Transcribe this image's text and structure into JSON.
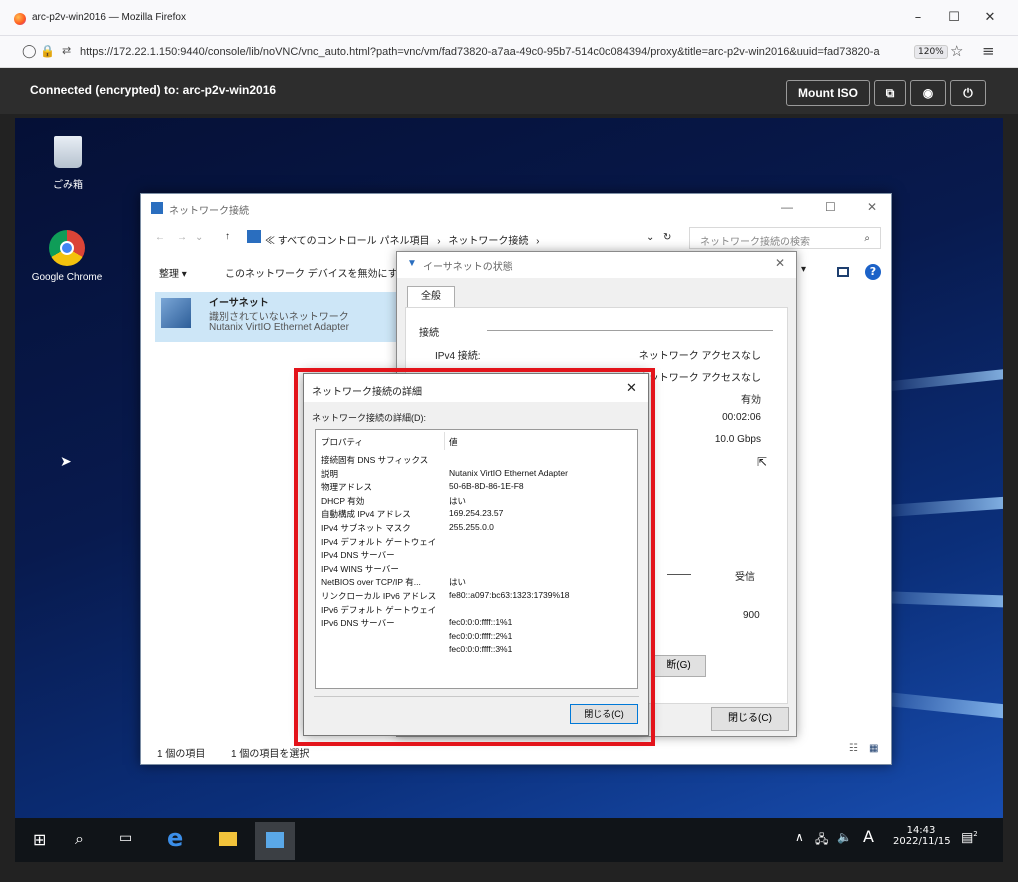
{
  "browser": {
    "tab_title": "arc-p2v-win2016 — Mozilla Firefox",
    "url": "https://172.22.1.150:9440/console/lib/noVNC/vnc_auto.html?path=vnc/vm/fad73820-a7aa-49c0-95b7-514c0c084394/proxy&title=arc-p2v-win2016&uuid=fad73820-a7",
    "url_host": "172.22.1.150",
    "zoom": "120%"
  },
  "novnc": {
    "connection": "Connected (encrypted) to: arc-p2v-win2016",
    "mount_iso": "Mount ISO"
  },
  "desktop": {
    "recycle_bin": "ごみ箱",
    "chrome": "Google Chrome"
  },
  "explorer": {
    "title": "ネットワーク接続",
    "breadcrumb": [
      "≪ すべてのコントロール パネル項目",
      "ネットワーク接続"
    ],
    "search_placeholder": "ネットワーク接続の検索",
    "toolbar": {
      "organize": "整理 ▾",
      "disable": "このネットワーク デバイスを無効にする"
    },
    "adapter": {
      "name": "イーサネット",
      "status": "識別されていないネットワーク",
      "device": "Nutanix VirtIO Ethernet Adapter"
    },
    "statusbar": {
      "count": "1 個の項目",
      "selected": "1 個の項目を選択"
    }
  },
  "status_dialog": {
    "title": "イーサネットの状態",
    "tab": "全般",
    "section": "接続",
    "rows": [
      {
        "label": "IPv4 接続:",
        "value": "ネットワーク アクセスなし"
      },
      {
        "label": "",
        "value": "ネットワーク アクセスなし"
      },
      {
        "label": "",
        "value": "有効"
      },
      {
        "label": "",
        "value": "00:02:06"
      },
      {
        "label": "",
        "value": "10.0 Gbps"
      }
    ],
    "activity_received": "受信",
    "bytes_received": "900",
    "diagnose_partial": "断(G)",
    "close": "閉じる(C)"
  },
  "details_dialog": {
    "title": "ネットワーク接続の詳細",
    "caption": "ネットワーク接続の詳細(D):",
    "col_property": "プロパティ",
    "col_value": "値",
    "rows": [
      {
        "p": "接続固有 DNS サフィックス",
        "v": ""
      },
      {
        "p": "説明",
        "v": "Nutanix VirtIO Ethernet Adapter"
      },
      {
        "p": "物理アドレス",
        "v": "50-6B-8D-86-1E-F8"
      },
      {
        "p": "DHCP 有効",
        "v": "はい"
      },
      {
        "p": "自動構成 IPv4 アドレス",
        "v": "169.254.23.57"
      },
      {
        "p": "IPv4 サブネット マスク",
        "v": "255.255.0.0"
      },
      {
        "p": "IPv4 デフォルト ゲートウェイ",
        "v": ""
      },
      {
        "p": "IPv4 DNS サーバー",
        "v": ""
      },
      {
        "p": "IPv4 WINS サーバー",
        "v": ""
      },
      {
        "p": "NetBIOS over TCP/IP 有...",
        "v": "はい"
      },
      {
        "p": "リンクローカル IPv6 アドレス",
        "v": "fe80::a097:bc63:1323:1739%18"
      },
      {
        "p": "IPv6 デフォルト ゲートウェイ",
        "v": ""
      },
      {
        "p": "IPv6 DNS サーバー",
        "v": "fec0:0:0:ffff::1%1"
      },
      {
        "p": "",
        "v": "fec0:0:0:ffff::2%1"
      },
      {
        "p": "",
        "v": "fec0:0:0:ffff::3%1"
      }
    ],
    "close": "閉じる(C)"
  },
  "taskbar": {
    "time": "14:43",
    "date": "2022/11/15",
    "ime": "A",
    "notif_count": "2"
  },
  "colors": {
    "highlight": "#e3141b",
    "novnc_bar": "#2d2d2d",
    "desktop": "#0b2f7a"
  }
}
